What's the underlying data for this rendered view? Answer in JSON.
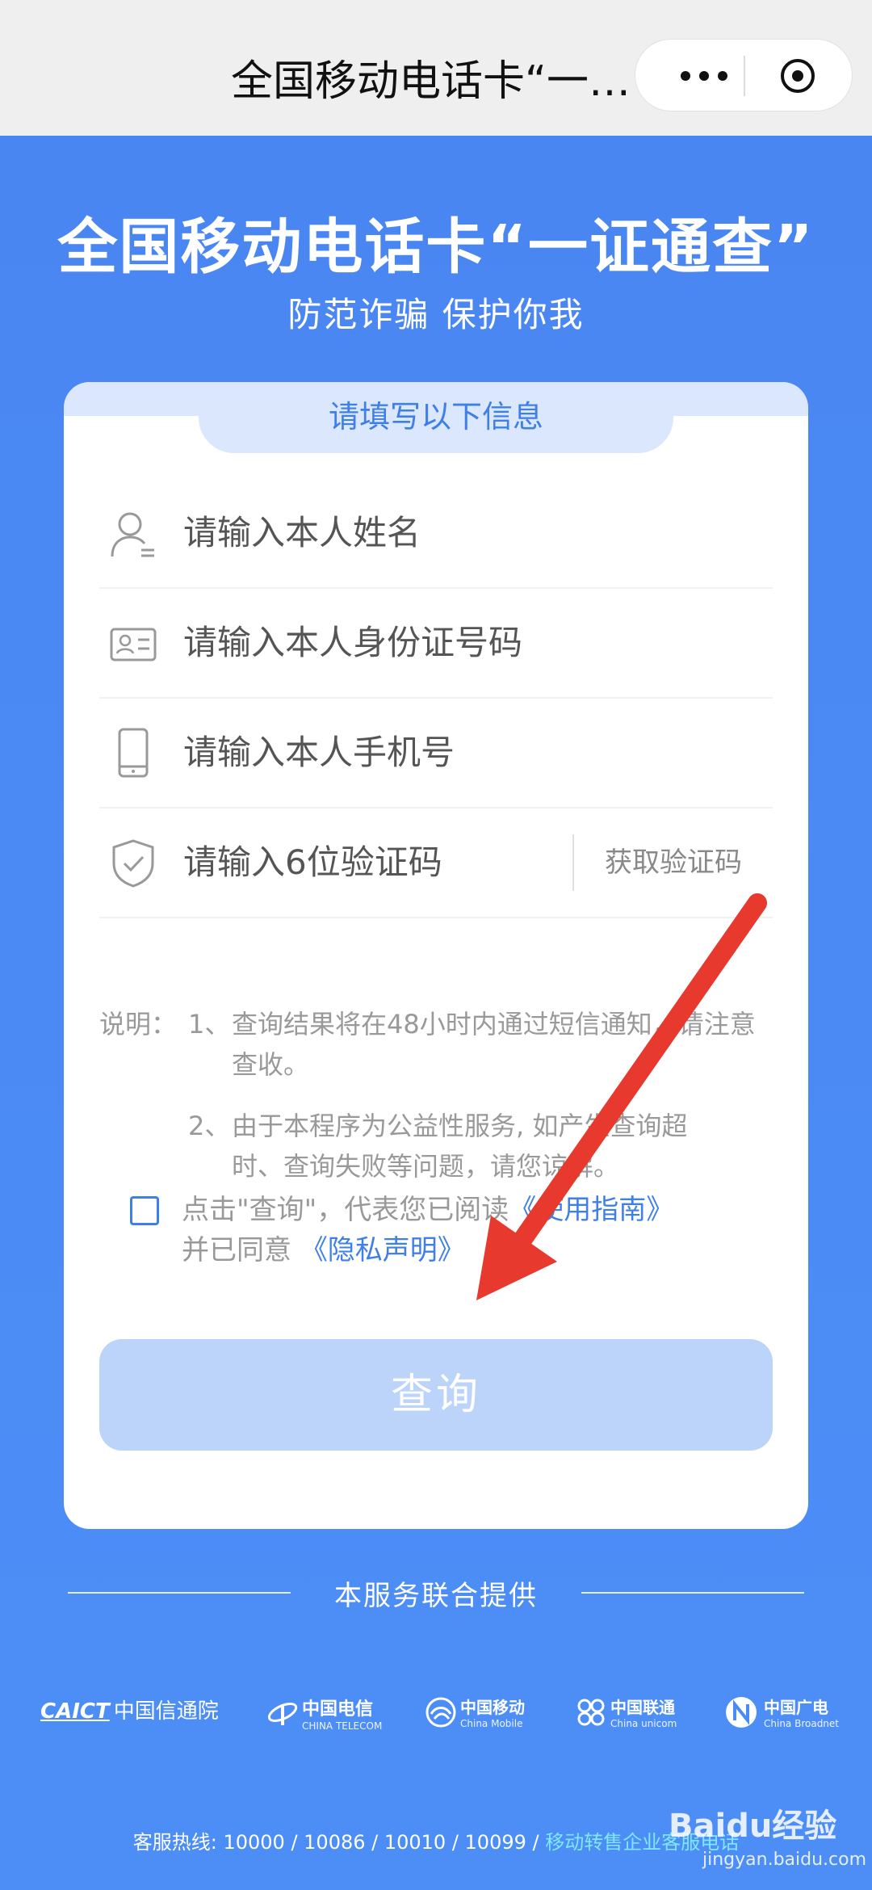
{
  "topbar": {
    "title": "全国移动电话卡“一…",
    "more_icon": "more-dots-icon",
    "close_icon": "close-circle-icon"
  },
  "hero": {
    "title": "全国移动电话卡“一证通查”",
    "subtitle": "防范诈骗 保护你我"
  },
  "form": {
    "header": "请填写以下信息",
    "name_placeholder": "请输入本人姓名",
    "id_placeholder": "请输入本人身份证号码",
    "phone_placeholder": "请输入本人手机号",
    "code_placeholder": "请输入6位验证码",
    "get_code_label": "获取验证码",
    "icons": {
      "name": "person-icon",
      "id": "id-card-icon",
      "phone": "phone-icon",
      "code": "shield-check-icon"
    }
  },
  "notes": {
    "label": "说明：",
    "items": [
      {
        "num": "1、",
        "text": "查询结果将在48小时内通过短信通知，请注意查收。"
      },
      {
        "num": "2、",
        "text": "由于本程序为公益性服务, 如产生查询超时、查询失败等问题，请您谅解。"
      }
    ]
  },
  "agreement": {
    "prefix": "点击\"查询\"，代表您已阅读",
    "guide_link": "《使用指南》",
    "and_text": "并已同意",
    "privacy_link": "《隐私声明》"
  },
  "submit": {
    "label": "查询"
  },
  "footer": {
    "title": "本服务联合提供",
    "providers": [
      {
        "name": "中国信通院",
        "prefix": "CAICT"
      },
      {
        "name": "中国电信",
        "sub": "CHINA TELECOM"
      },
      {
        "name": "中国移动",
        "sub": "China Mobile"
      },
      {
        "name": "中国联通",
        "sub": "China unicom"
      },
      {
        "name": "中国广电",
        "sub": "China Broadnet"
      }
    ],
    "hotline_prefix": "客服热线: 10000 / 10086 / 10010 / 10099 / ",
    "hotline_link": "移动转售企业客服电话"
  },
  "watermark": {
    "brand": "Baidu经验",
    "url": "jingyan.baidu.com"
  },
  "colors": {
    "brand_blue": "#4b8bf5",
    "link_blue": "#3f7fe8",
    "button_disabled": "#bcd3fa",
    "arrow_red": "#e8392e"
  }
}
